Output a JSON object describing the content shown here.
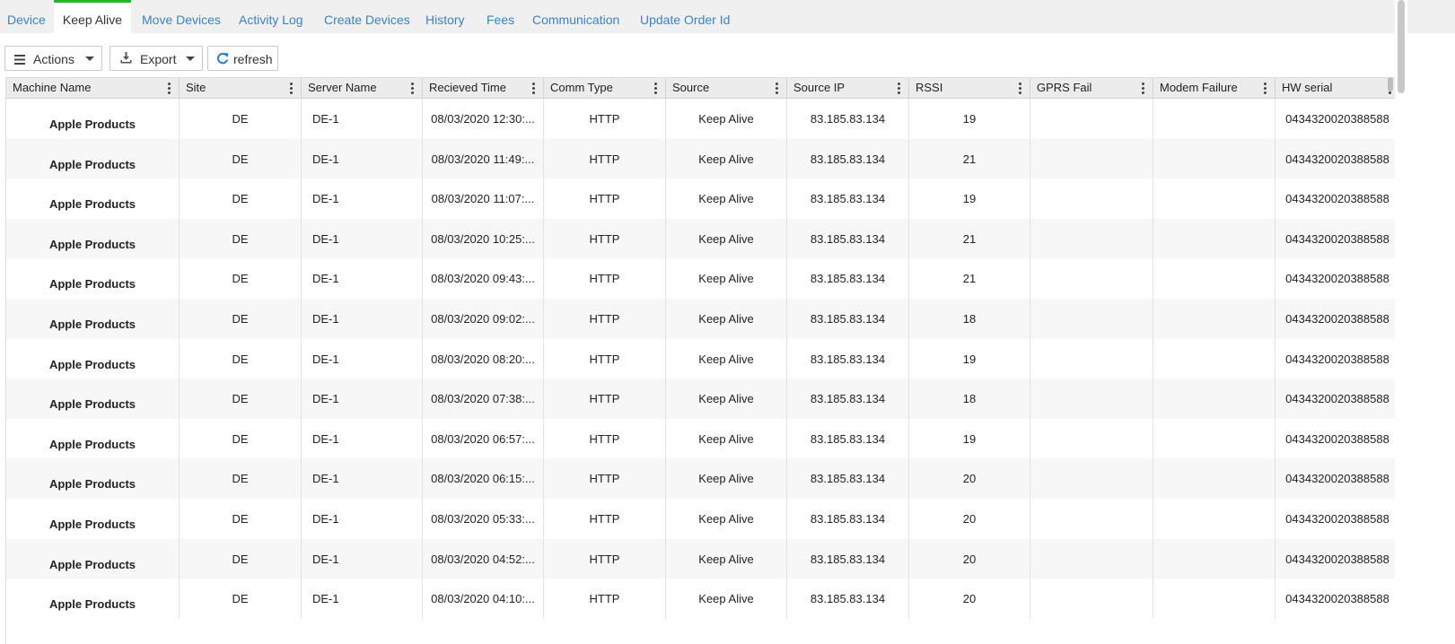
{
  "tabs": [
    {
      "label": "Device",
      "active": false
    },
    {
      "label": "Keep Alive",
      "active": true
    },
    {
      "label": "Move Devices",
      "active": false
    },
    {
      "label": "Activity Log",
      "active": false
    },
    {
      "label": "Create Devices",
      "active": false
    },
    {
      "label": "History",
      "active": false
    },
    {
      "label": "Fees",
      "active": false
    },
    {
      "label": "Communication",
      "active": false
    },
    {
      "label": "Update Order Id",
      "active": false
    }
  ],
  "toolbar": {
    "actions_label": "Actions",
    "actions_icon": "menu-icon",
    "export_label": "Export",
    "export_icon": "download-icon",
    "refresh_label": "refresh",
    "refresh_icon": "refresh-icon"
  },
  "colors": {
    "link": "#3a82c4",
    "active_tab_border": "#2bb52b",
    "refresh_icon": "#2a7fc9"
  },
  "grid": {
    "columns": [
      "Machine Name",
      "Site",
      "Server Name",
      "Recieved Time",
      "Comm Type",
      "Source",
      "Source IP",
      "RSSI",
      "GPRS Fail",
      "Modem Failure",
      "HW serial"
    ],
    "rows": [
      [
        "Apple Products",
        "DE",
        "DE-1",
        "08/03/2020 12:30:...",
        "HTTP",
        "Keep Alive",
        "83.185.83.134",
        "19",
        "",
        "",
        "0434320020388588"
      ],
      [
        "Apple Products",
        "DE",
        "DE-1",
        "08/03/2020 11:49:...",
        "HTTP",
        "Keep Alive",
        "83.185.83.134",
        "21",
        "",
        "",
        "0434320020388588"
      ],
      [
        "Apple Products",
        "DE",
        "DE-1",
        "08/03/2020 11:07:...",
        "HTTP",
        "Keep Alive",
        "83.185.83.134",
        "19",
        "",
        "",
        "0434320020388588"
      ],
      [
        "Apple Products",
        "DE",
        "DE-1",
        "08/03/2020 10:25:...",
        "HTTP",
        "Keep Alive",
        "83.185.83.134",
        "21",
        "",
        "",
        "0434320020388588"
      ],
      [
        "Apple Products",
        "DE",
        "DE-1",
        "08/03/2020 09:43:...",
        "HTTP",
        "Keep Alive",
        "83.185.83.134",
        "21",
        "",
        "",
        "0434320020388588"
      ],
      [
        "Apple Products",
        "DE",
        "DE-1",
        "08/03/2020 09:02:...",
        "HTTP",
        "Keep Alive",
        "83.185.83.134",
        "18",
        "",
        "",
        "0434320020388588"
      ],
      [
        "Apple Products",
        "DE",
        "DE-1",
        "08/03/2020 08:20:...",
        "HTTP",
        "Keep Alive",
        "83.185.83.134",
        "19",
        "",
        "",
        "0434320020388588"
      ],
      [
        "Apple Products",
        "DE",
        "DE-1",
        "08/03/2020 07:38:...",
        "HTTP",
        "Keep Alive",
        "83.185.83.134",
        "18",
        "",
        "",
        "0434320020388588"
      ],
      [
        "Apple Products",
        "DE",
        "DE-1",
        "08/03/2020 06:57:...",
        "HTTP",
        "Keep Alive",
        "83.185.83.134",
        "19",
        "",
        "",
        "0434320020388588"
      ],
      [
        "Apple Products",
        "DE",
        "DE-1",
        "08/03/2020 06:15:...",
        "HTTP",
        "Keep Alive",
        "83.185.83.134",
        "20",
        "",
        "",
        "0434320020388588"
      ],
      [
        "Apple Products",
        "DE",
        "DE-1",
        "08/03/2020 05:33:...",
        "HTTP",
        "Keep Alive",
        "83.185.83.134",
        "20",
        "",
        "",
        "0434320020388588"
      ],
      [
        "Apple Products",
        "DE",
        "DE-1",
        "08/03/2020 04:52:...",
        "HTTP",
        "Keep Alive",
        "83.185.83.134",
        "20",
        "",
        "",
        "0434320020388588"
      ],
      [
        "Apple Products",
        "DE",
        "DE-1",
        "08/03/2020 04:10:...",
        "HTTP",
        "Keep Alive",
        "83.185.83.134",
        "20",
        "",
        "",
        "0434320020388588"
      ]
    ]
  }
}
